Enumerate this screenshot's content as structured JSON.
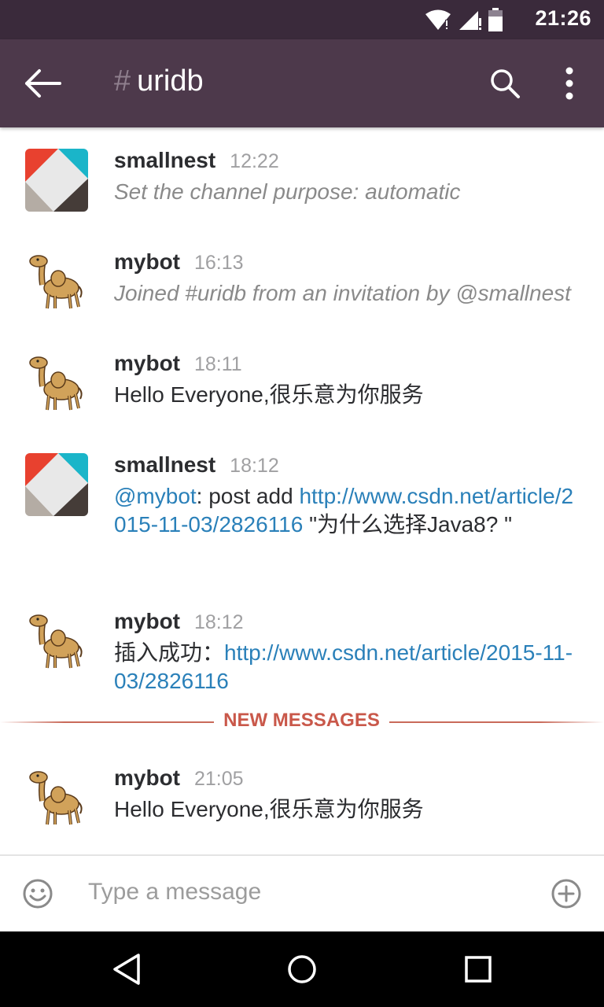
{
  "status_bar": {
    "time": "21:26"
  },
  "header": {
    "hash": "#",
    "channel": "uridb"
  },
  "messages": [
    {
      "author": "smallnest",
      "time": "12:22",
      "text": "Set the channel purpose: automatic"
    },
    {
      "author": "mybot",
      "time": "16:13",
      "text": "Joined #uridb from an invitation by @smallnest"
    },
    {
      "author": "mybot",
      "time": "18:11",
      "text": "Hello Everyone,很乐意为你服务"
    },
    {
      "author": "smallnest",
      "time": "18:12",
      "mention": "@mybot",
      "text_a": ": post add ",
      "link": "http://www.csdn.net/article/2015-11-03/2826116",
      "text_b": " \"为什么选择Java8? \""
    },
    {
      "author": "mybot",
      "time": "18:12",
      "text_a": "插入成功：",
      "link": "http://www.csdn.net/article/2015-11-03/2826116"
    },
    {
      "author": "mybot",
      "time": "21:05",
      "text": "Hello Everyone,很乐意为你服务"
    }
  ],
  "divider": {
    "label": "NEW MESSAGES"
  },
  "composer": {
    "placeholder": "Type a message"
  },
  "icons": {
    "back": "arrow-left-icon",
    "search": "search-icon",
    "more": "more-vert-icon",
    "emoji": "smiley-icon",
    "attach": "plus-circle-icon",
    "wifi": "wifi-icon",
    "signal": "signal-icon",
    "battery": "battery-icon"
  },
  "colors": {
    "status_bar": "#3a2a3b",
    "app_bar": "#4d394b",
    "link": "#2a80b9",
    "new_messages": "#c9584a"
  }
}
